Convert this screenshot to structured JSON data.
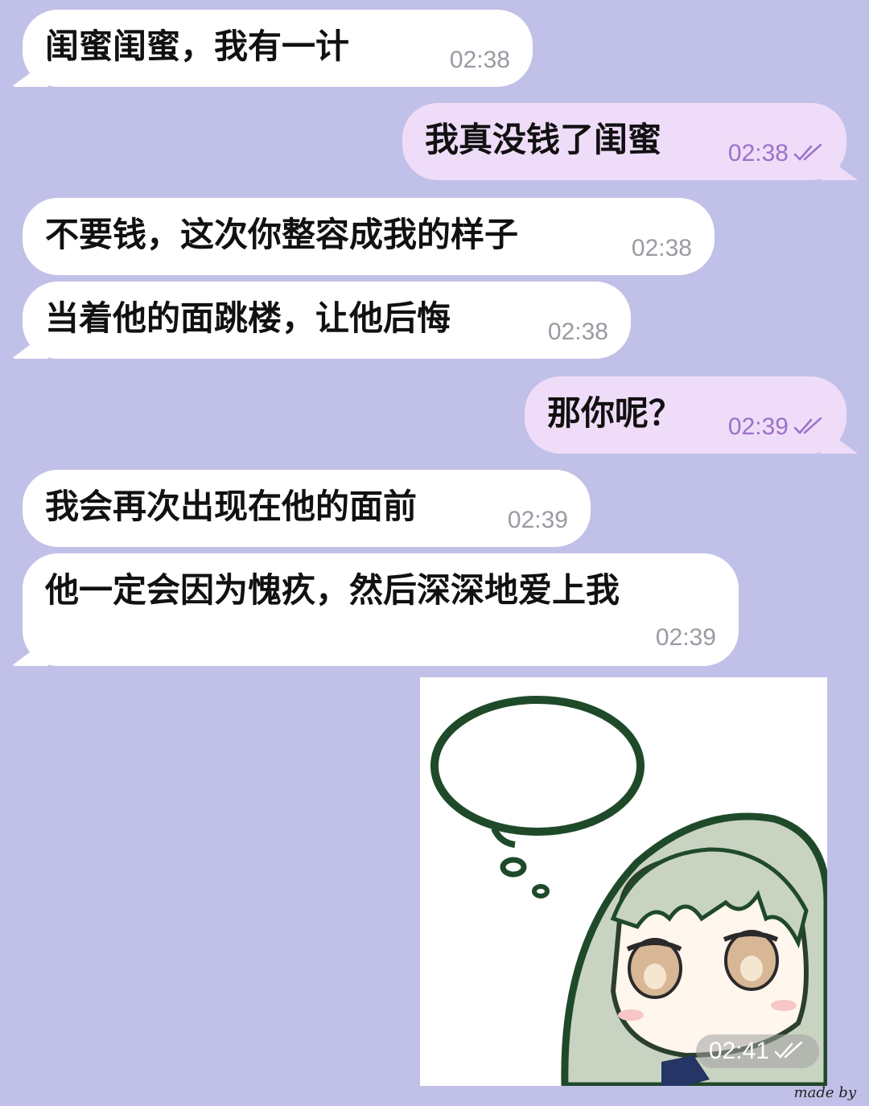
{
  "messages": [
    {
      "id": "m1",
      "direction": "in",
      "text": "闺蜜闺蜜，我有一计",
      "time": "02:38"
    },
    {
      "id": "m2",
      "direction": "out",
      "text": "我真没钱了闺蜜",
      "time": "02:38",
      "status": "read-double-check-icon"
    },
    {
      "id": "m3",
      "direction": "in",
      "text": "不要钱，这次你整容成我的样子",
      "time": "02:38"
    },
    {
      "id": "m4",
      "direction": "in",
      "text": "当着他的面跳楼，让他后悔",
      "time": "02:38"
    },
    {
      "id": "m5",
      "direction": "out",
      "text": "那你呢？",
      "time": "02:39",
      "status": "read-double-check-icon"
    },
    {
      "id": "m6",
      "direction": "in",
      "text": "我会再次出现在他的面前",
      "time": "02:39"
    },
    {
      "id": "m7",
      "direction": "in",
      "text": "他一定会因为愧疚，然后深深地爱上我",
      "time": "02:39"
    }
  ],
  "sticker": {
    "time": "02:41",
    "status": "read-double-check-icon",
    "icon": "anime-girl-thought-bubble-sticker"
  },
  "watermark": "made by",
  "colors": {
    "chat_background": "#c1c0e8",
    "incoming_bubble": "#ffffff",
    "outgoing_bubble": "#efdcf8",
    "outgoing_time": "#9a72c8"
  }
}
